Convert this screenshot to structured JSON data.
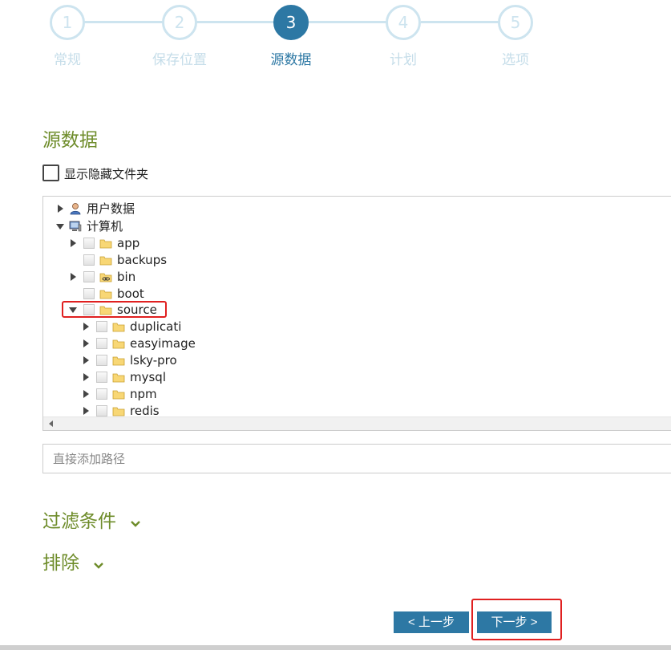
{
  "wizard": {
    "steps": [
      {
        "number": "1",
        "label": "常规"
      },
      {
        "number": "2",
        "label": "保存位置"
      },
      {
        "number": "3",
        "label": "源数据"
      },
      {
        "number": "4",
        "label": "计划"
      },
      {
        "number": "5",
        "label": "选项"
      }
    ],
    "active_step": 3,
    "colors": {
      "active": "#2d78a4",
      "inactive": "#cde4ef",
      "section_title": "#6e8c2a",
      "highlight": "#e02020"
    }
  },
  "section": {
    "title": "源数据"
  },
  "show_hidden": {
    "label": "显示隐藏文件夹",
    "checked": false
  },
  "tree": {
    "nodes": [
      {
        "label": "用户数据",
        "icon": "user-icon",
        "expanded": false
      },
      {
        "label": "计算机",
        "icon": "computer-icon",
        "expanded": true
      },
      {
        "label": "app",
        "icon": "folder-icon",
        "expanded": false
      },
      {
        "label": "backups",
        "icon": "folder-icon",
        "expanded": null
      },
      {
        "label": "bin",
        "icon": "folder-link-icon",
        "expanded": false
      },
      {
        "label": "boot",
        "icon": "folder-icon",
        "expanded": null
      },
      {
        "label": "source",
        "icon": "folder-icon",
        "expanded": true
      },
      {
        "label": "duplicati",
        "icon": "folder-icon",
        "expanded": false
      },
      {
        "label": "easyimage",
        "icon": "folder-icon",
        "expanded": false
      },
      {
        "label": "lsky-pro",
        "icon": "folder-icon",
        "expanded": false
      },
      {
        "label": "mysql",
        "icon": "folder-icon",
        "expanded": false
      },
      {
        "label": "npm",
        "icon": "folder-icon",
        "expanded": false
      },
      {
        "label": "redis",
        "icon": "folder-icon",
        "expanded": false
      }
    ]
  },
  "path_input": {
    "placeholder": "直接添加路径",
    "value": ""
  },
  "filters": {
    "title": "过滤条件"
  },
  "excludes": {
    "title": "排除"
  },
  "buttons": {
    "prev": "< 上一步",
    "next": "下一步 >"
  }
}
